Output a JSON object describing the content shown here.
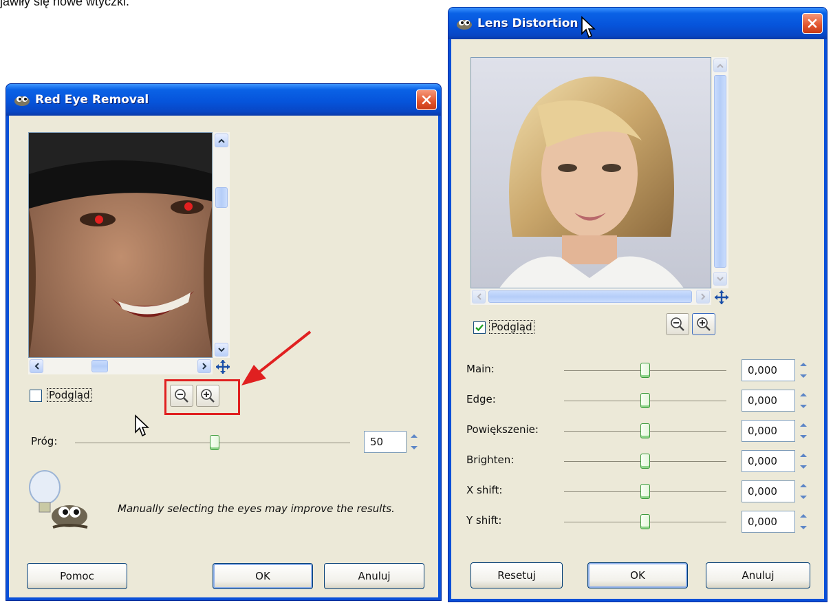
{
  "document_text": "jawiły się nowe wtyczki.",
  "red_eye_dialog": {
    "title": "Red Eye Removal",
    "title_icon": "gimp-wilber-icon",
    "close_icon": "close-icon",
    "preview_image": "red-eye-preview-image",
    "preview_label": "Podgląd",
    "preview_checked": false,
    "zoom_out_icon": "zoom-out-icon",
    "zoom_in_icon": "zoom-in-icon",
    "threshold_label": "Próg:",
    "threshold_value": "50",
    "threshold_fraction": 0.52,
    "hint_icon": "gimp-tip-icon",
    "hint_text": "Manually selecting the eyes may improve the results.",
    "buttons": {
      "help": "Pomoc",
      "ok": "OK",
      "cancel": "Anuluj"
    }
  },
  "lens_dialog": {
    "title": "Lens Distortion",
    "title_icon": "gimp-wilber-icon",
    "close_icon": "close-icon",
    "preview_image": "portrait-preview-image",
    "preview_label": "Podgląd",
    "preview_checked": true,
    "zoom_out_icon": "zoom-out-icon",
    "zoom_in_icon": "zoom-in-icon",
    "params": [
      {
        "label": "Main:",
        "value": "0,000",
        "fraction": 0.5
      },
      {
        "label": "Edge:",
        "value": "0,000",
        "fraction": 0.5
      },
      {
        "label": "Powiększenie:",
        "value": "0,000",
        "fraction": 0.5
      },
      {
        "label": "Brighten:",
        "value": "0,000",
        "fraction": 0.5
      },
      {
        "label": "X shift:",
        "value": "0,000",
        "fraction": 0.5
      },
      {
        "label": "Y shift:",
        "value": "0,000",
        "fraction": 0.5
      }
    ],
    "buttons": {
      "reset": "Resetuj",
      "ok": "OK",
      "cancel": "Anuluj"
    }
  },
  "annotation": {
    "color": "#e02020"
  },
  "colors": {
    "titlebar": "#0654db",
    "client_bg": "#ece9d8",
    "close_button": "#e2542c",
    "slider_thumb_border": "#3b9a3b"
  }
}
